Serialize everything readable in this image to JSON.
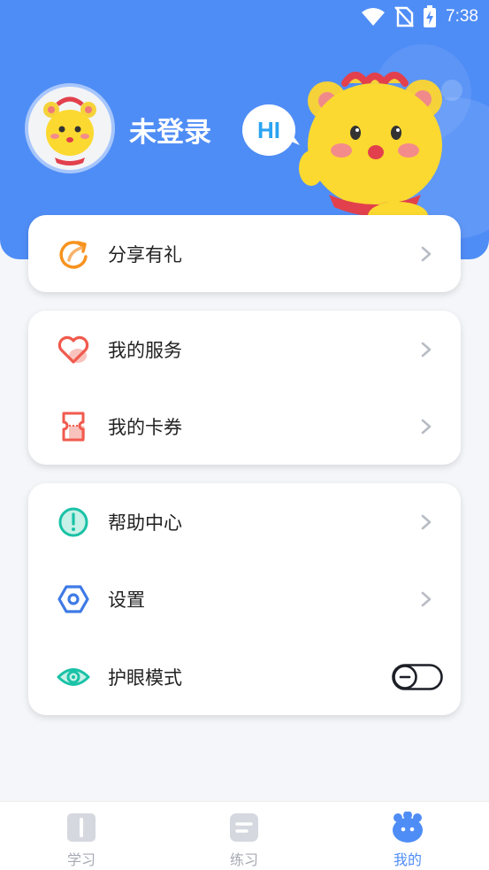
{
  "status_bar": {
    "time": "7:38",
    "icons": [
      "wifi-icon",
      "no-sim-icon",
      "battery-charging-icon"
    ]
  },
  "profile": {
    "username": "未登录",
    "greeting": "HI"
  },
  "menu": {
    "share": {
      "label": "分享有礼",
      "icon": "share-gift-icon"
    },
    "services": {
      "label": "我的服务",
      "icon": "heart-icon"
    },
    "coupons": {
      "label": "我的卡券",
      "icon": "ticket-icon"
    },
    "help": {
      "label": "帮助中心",
      "icon": "help-icon"
    },
    "settings": {
      "label": "设置",
      "icon": "settings-hex-icon"
    },
    "eye_mode": {
      "label": "护眼模式",
      "icon": "eye-icon",
      "enabled": false
    }
  },
  "tabbar": {
    "tabs": [
      {
        "label": "学习",
        "icon": "book-icon",
        "active": false
      },
      {
        "label": "练习",
        "icon": "practice-icon",
        "active": false
      },
      {
        "label": "我的",
        "icon": "mascot-face-icon",
        "active": true
      }
    ]
  },
  "colors": {
    "primary": "#4f8df6",
    "background": "#f4f6f9",
    "orange": "#f7931e",
    "red": "#f05a4d",
    "teal": "#19c2a6"
  }
}
